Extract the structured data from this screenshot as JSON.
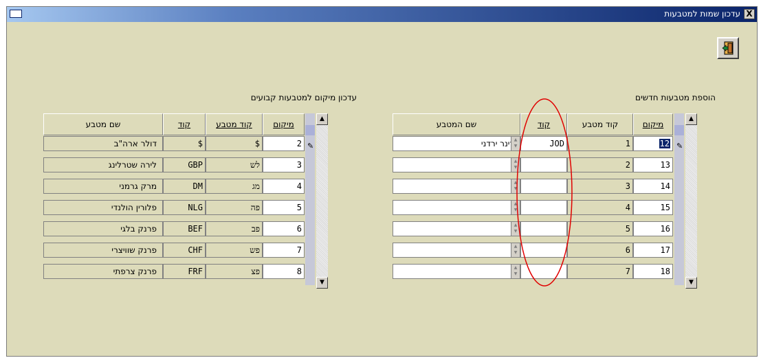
{
  "window": {
    "title": "עדכון שמות למטבעות",
    "close_label": "X"
  },
  "right_panel": {
    "title": "הוספת מטבעות חדשים",
    "headers": {
      "location": "מיקום",
      "currency_code": "קוד מטבע",
      "code": "קוד",
      "currency_name": "שם המטבע"
    },
    "rows": [
      {
        "location": "12",
        "currency_code": "1",
        "code": "JOD",
        "name": "דינר ירדני"
      },
      {
        "location": "13",
        "currency_code": "2",
        "code": "",
        "name": ""
      },
      {
        "location": "14",
        "currency_code": "3",
        "code": "",
        "name": ""
      },
      {
        "location": "15",
        "currency_code": "4",
        "code": "",
        "name": ""
      },
      {
        "location": "16",
        "currency_code": "5",
        "code": "",
        "name": ""
      },
      {
        "location": "17",
        "currency_code": "6",
        "code": "",
        "name": ""
      },
      {
        "location": "18",
        "currency_code": "7",
        "code": "",
        "name": ""
      }
    ]
  },
  "left_panel": {
    "title": "עדכון מיקום למטבעות קבועים",
    "headers": {
      "location": "מיקום",
      "currency_code": "קוד מטבע",
      "code": "קוד",
      "currency_name": "שם מטבע"
    },
    "rows": [
      {
        "location": "2",
        "currency_code": "$",
        "code": "$",
        "name": "דולר ארה\"ב"
      },
      {
        "location": "3",
        "currency_code": "לש",
        "code": "GBP",
        "name": "לירה שטרלינג"
      },
      {
        "location": "4",
        "currency_code": "מג",
        "code": "DM",
        "name": "מרק גרמני"
      },
      {
        "location": "5",
        "currency_code": "פה",
        "code": "NLG",
        "name": "פלורין הולנדי"
      },
      {
        "location": "6",
        "currency_code": "פב",
        "code": "BEF",
        "name": "פרנק בלגי"
      },
      {
        "location": "7",
        "currency_code": "פש",
        "code": "CHF",
        "name": "פרנק שוויצרי"
      },
      {
        "location": "8",
        "currency_code": "פצ",
        "code": "FRF",
        "name": "פרנק צרפתי"
      }
    ]
  },
  "icons": {
    "exit": "exit-door-icon",
    "edit_pencil": "pencil-icon"
  },
  "colors": {
    "window_bg": "#dddbba",
    "titlebar": "#0a246a",
    "annotation": "#e00000"
  }
}
